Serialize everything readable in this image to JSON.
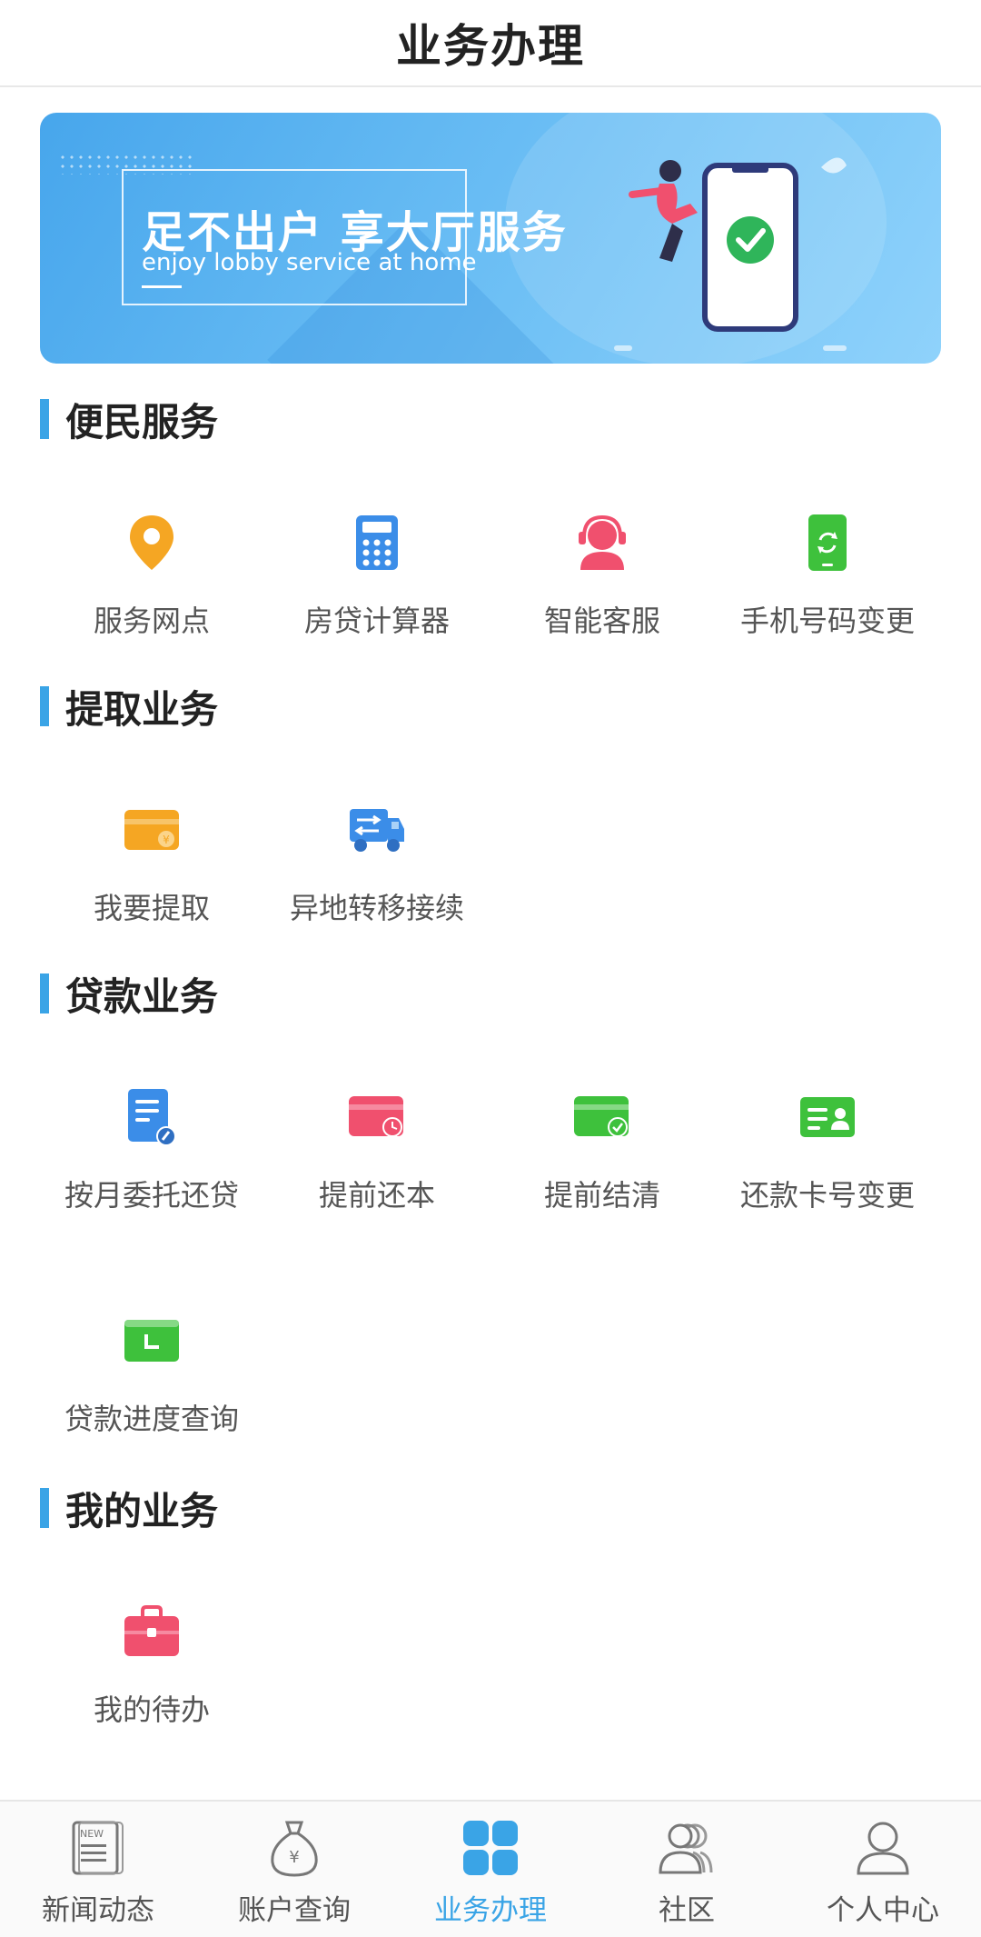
{
  "header": {
    "title": "业务办理"
  },
  "banner": {
    "title": "足不出户 享大厅服务",
    "subtitle": "enjoy lobby service at home"
  },
  "sections": [
    {
      "title": "便民服务",
      "items": [
        {
          "label": "服务网点",
          "icon": "location-pin-icon",
          "color": "#f5a623"
        },
        {
          "label": "房贷计算器",
          "icon": "calculator-icon",
          "color": "#3b8de8"
        },
        {
          "label": "智能客服",
          "icon": "customer-service-icon",
          "color": "#f0506e"
        },
        {
          "label": "手机号码变更",
          "icon": "phone-refresh-icon",
          "color": "#3ec13c"
        }
      ]
    },
    {
      "title": "提取业务",
      "items": [
        {
          "label": "我要提取",
          "icon": "wallet-yuan-icon",
          "color": "#f5a623"
        },
        {
          "label": "异地转移接续",
          "icon": "transfer-truck-icon",
          "color": "#3b8de8"
        }
      ]
    },
    {
      "title": "贷款业务",
      "items": [
        {
          "label": "按月委托还贷",
          "icon": "document-edit-icon",
          "color": "#3b8de8"
        },
        {
          "label": "提前还本",
          "icon": "card-clock-icon",
          "color": "#f0506e"
        },
        {
          "label": "提前结清",
          "icon": "card-check-icon",
          "color": "#3ec13c"
        },
        {
          "label": "还款卡号变更",
          "icon": "id-card-icon",
          "color": "#3ec13c"
        },
        {
          "label": "贷款进度查询",
          "icon": "progress-card-icon",
          "color": "#3ec13c"
        }
      ]
    },
    {
      "title": "我的业务",
      "items": [
        {
          "label": "我的待办",
          "icon": "briefcase-icon",
          "color": "#f0506e"
        }
      ]
    }
  ],
  "tabbar": {
    "active_color": "#3aa4e6",
    "tabs": [
      {
        "label": "新闻动态",
        "icon": "news-icon",
        "active": false
      },
      {
        "label": "账户查询",
        "icon": "money-bag-icon",
        "active": false
      },
      {
        "label": "业务办理",
        "icon": "grid-icon",
        "active": true
      },
      {
        "label": "社区",
        "icon": "community-icon",
        "active": false
      },
      {
        "label": "个人中心",
        "icon": "user-icon",
        "active": false
      }
    ]
  }
}
